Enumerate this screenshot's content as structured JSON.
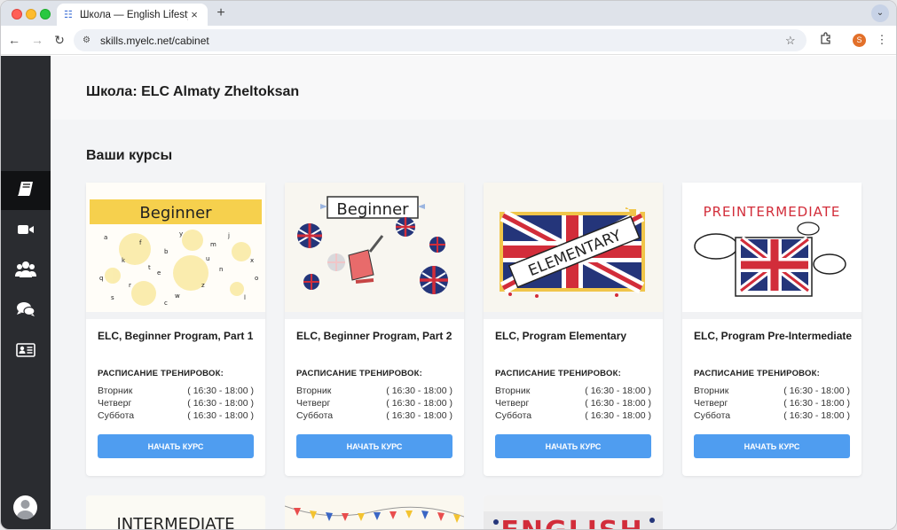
{
  "browser": {
    "tab_title": "Школа — English Lifestyle Co",
    "url": "skills.myelc.net/cabinet",
    "profile_initial": "S"
  },
  "sidebar": {
    "items": [
      {
        "icon": "book-icon",
        "active": true
      },
      {
        "icon": "video-icon",
        "active": false
      },
      {
        "icon": "group-icon",
        "active": false
      },
      {
        "icon": "chat-icon",
        "active": false
      },
      {
        "icon": "id-card-icon",
        "active": false
      }
    ]
  },
  "page": {
    "school_title": "Школа: ELC Almaty Zheltoksan",
    "courses_title": "Ваши курсы"
  },
  "courses": [
    {
      "name": "ELC, Beginner Program, Part 1",
      "image_text": "Beginner",
      "schedule_label": "РАСПИСАНИЕ ТРЕНИРОВОК:",
      "schedule": [
        {
          "day": "Вторник",
          "time": "( 16:30 - 18:00 )"
        },
        {
          "day": "Четверг",
          "time": "( 16:30 - 18:00 )"
        },
        {
          "day": "Суббота",
          "time": "( 16:30 - 18:00 )"
        }
      ],
      "button": "НАЧАТЬ КУРС"
    },
    {
      "name": "ELC, Beginner Program, Part 2",
      "image_text": "Beginner",
      "schedule_label": "РАСПИСАНИЕ ТРЕНИРОВОК:",
      "schedule": [
        {
          "day": "Вторник",
          "time": "( 16:30 - 18:00 )"
        },
        {
          "day": "Четверг",
          "time": "( 16:30 - 18:00 )"
        },
        {
          "day": "Суббота",
          "time": "( 16:30 - 18:00 )"
        }
      ],
      "button": "НАЧАТЬ КУРС"
    },
    {
      "name": "ELC, Program Elementary",
      "image_text": "ELEMENTARY",
      "schedule_label": "РАСПИСАНИЕ ТРЕНИРОВОК:",
      "schedule": [
        {
          "day": "Вторник",
          "time": "( 16:30 - 18:00 )"
        },
        {
          "day": "Четверг",
          "time": "( 16:30 - 18:00 )"
        },
        {
          "day": "Суббота",
          "time": "( 16:30 - 18:00 )"
        }
      ],
      "button": "НАЧАТЬ КУРС"
    },
    {
      "name": "ELC, Program Pre-Intermediate",
      "image_text": "PREINTERMEDIATE",
      "schedule_label": "РАСПИСАНИЕ ТРЕНИРОВОК:",
      "schedule": [
        {
          "day": "Вторник",
          "time": "( 16:30 - 18:00 )"
        },
        {
          "day": "Четверг",
          "time": "( 16:30 - 18:00 )"
        },
        {
          "day": "Суббота",
          "time": "( 16:30 - 18:00 )"
        }
      ],
      "button": "НАЧАТЬ КУРС"
    }
  ],
  "courses_row2": [
    {
      "image_text": "INTERMEDIATE"
    },
    {
      "image_text": ""
    },
    {
      "image_text": "ENGLISH"
    }
  ],
  "colors": {
    "accent_button": "#4f9df0",
    "sidebar": "#2a2c30",
    "flag_blue": "#24357a",
    "flag_red": "#d22d3a",
    "beginner_yellow": "#f6d04d"
  }
}
